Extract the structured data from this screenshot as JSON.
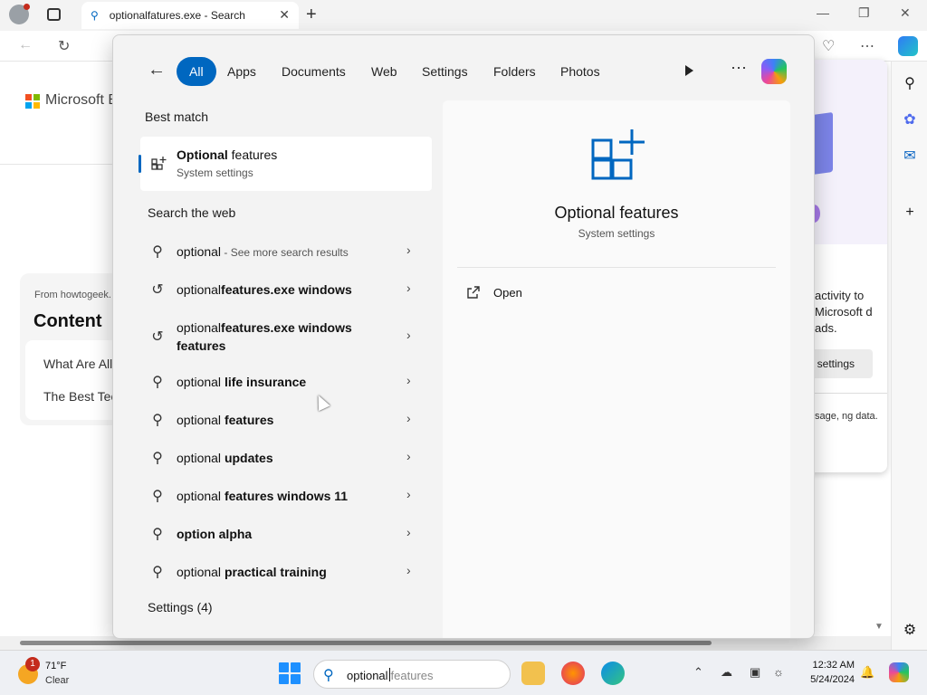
{
  "browser": {
    "tab_title": "optionalfatures.exe - Search",
    "page_brand": "Microsoft B",
    "card_from": "From howtogeek...",
    "card_heading": "Content",
    "card_item_1": "What Are All",
    "card_item_2": "The Best Tec",
    "popup_text": "activity to Microsoft d ads.",
    "popup_button": "settings",
    "popup_small": "sage, ng data."
  },
  "search_panel": {
    "filters": [
      "All",
      "Apps",
      "Documents",
      "Web",
      "Settings",
      "Folders",
      "Photos"
    ],
    "active_filter": "All",
    "best_match_heading": "Best match",
    "best_match": {
      "title_bold": "Optional",
      "title_rest": " features",
      "subtitle": "System settings"
    },
    "web_heading": "Search the web",
    "web_items": [
      {
        "icon": "search-icon",
        "prefix": "optional",
        "bold": "",
        "hint": " - See more search results"
      },
      {
        "icon": "history-icon",
        "prefix": "optional",
        "bold": "features.exe windows",
        "hint": ""
      },
      {
        "icon": "history-icon",
        "prefix": "optional",
        "bold": "features.exe windows features",
        "hint": ""
      },
      {
        "icon": "search-icon",
        "prefix": "optional ",
        "bold": "life insurance",
        "hint": ""
      },
      {
        "icon": "search-icon",
        "prefix": "optional ",
        "bold": "features",
        "hint": ""
      },
      {
        "icon": "search-icon",
        "prefix": "optional ",
        "bold": "updates",
        "hint": ""
      },
      {
        "icon": "search-icon",
        "prefix": "optional ",
        "bold": "features windows 11",
        "hint": ""
      },
      {
        "icon": "search-icon",
        "prefix": "",
        "bold": "option alpha",
        "hint": ""
      },
      {
        "icon": "search-icon",
        "prefix": "optional ",
        "bold": "practical training",
        "hint": ""
      }
    ],
    "settings_heading": "Settings (4)",
    "preview": {
      "title": "Optional features",
      "subtitle": "System settings",
      "open_label": "Open"
    }
  },
  "taskbar": {
    "weather_badge": "1",
    "temperature": "71°F",
    "condition": "Clear",
    "search_typed": "optional",
    "search_suggest": "features",
    "time": "12:32 AM",
    "date": "5/24/2024"
  },
  "colors": {
    "accent": "#0067c0",
    "panel_bg": "#f3f3f3"
  }
}
